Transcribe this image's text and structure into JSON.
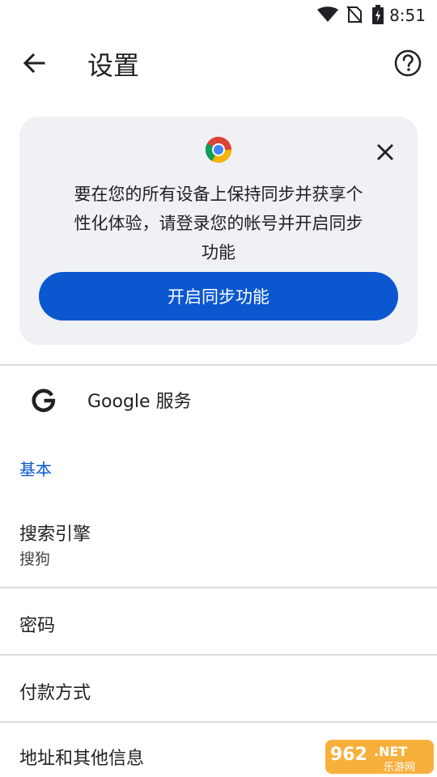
{
  "status_bar": {
    "time": "8:51"
  },
  "app_bar": {
    "title": "设置"
  },
  "sync_promo": {
    "message_line1": "要在您的所有设备上保持同步并获享个",
    "message_line2": "性化体验，请登录您的帐号并开启同步",
    "message_line3": "功能",
    "button_label": "开启同步功能"
  },
  "google_services": {
    "label": "Google 服务"
  },
  "basics": {
    "header": "基本",
    "items": [
      {
        "label": "搜索引擎",
        "summary": "搜狗"
      },
      {
        "label": "密码"
      },
      {
        "label": "付款方式"
      },
      {
        "label": "地址和其他信息"
      }
    ]
  },
  "watermark": {
    "text": "962.NET 乐游网"
  },
  "colors": {
    "accent": "#0b57d0",
    "card_bg": "#eff1f5",
    "divider": "#dadce0"
  }
}
